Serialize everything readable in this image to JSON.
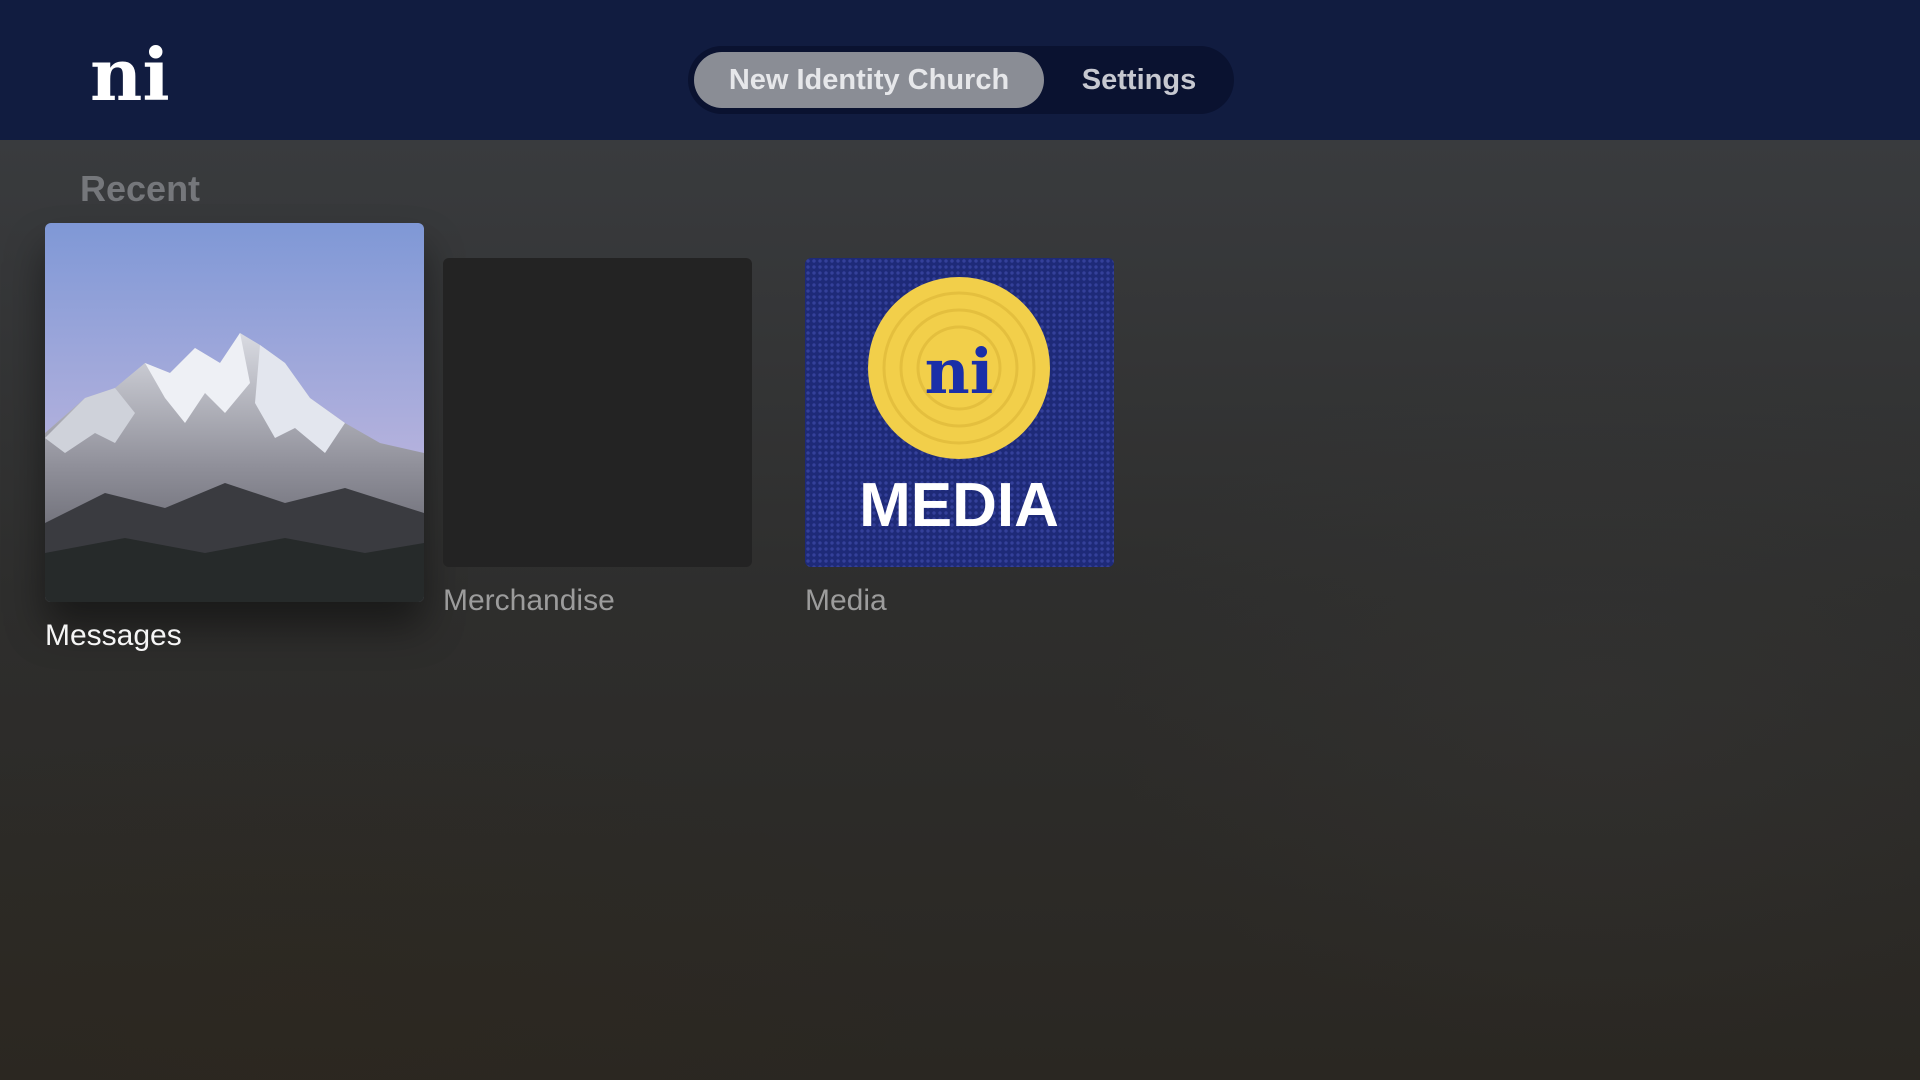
{
  "logo": {
    "text": "ni",
    "color": "#ffffff"
  },
  "tabs": [
    {
      "label": "New Identity Church",
      "active": true
    },
    {
      "label": "Settings",
      "active": false
    }
  ],
  "recent": {
    "title": "Recent",
    "items": [
      {
        "label": "Messages",
        "image": "mountain-photo",
        "focused": true
      },
      {
        "label": "Merchandise",
        "image": "blank"
      },
      {
        "label": "Media",
        "image": "media-logo",
        "logo_text": "ni",
        "wordmark": "MEDIA"
      }
    ]
  },
  "colors": {
    "topbar": "#111c40",
    "media_tile": "#1e2a78",
    "media_circle": "#f2cf4a",
    "logo_blue": "#1a2fa8"
  }
}
